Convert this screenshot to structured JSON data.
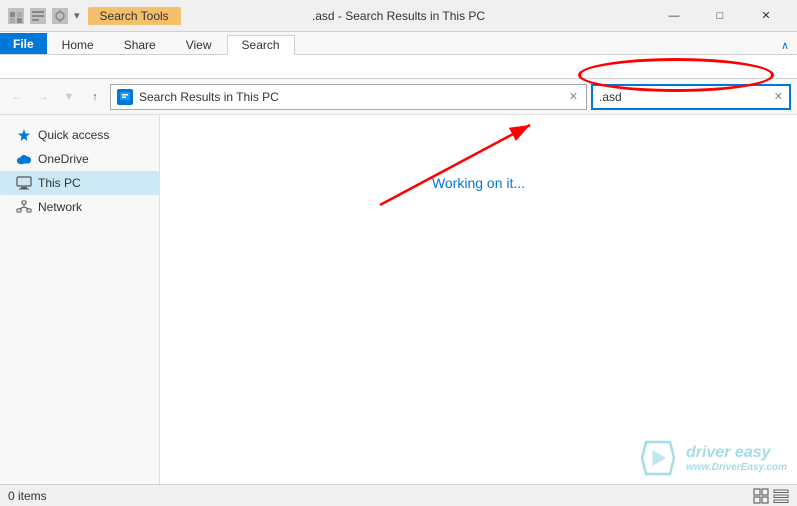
{
  "titlebar": {
    "search_tools_label": "Search Tools",
    "title": ".asd - Search Results in This PC",
    "minimize": "—",
    "maximize": "□",
    "close": "✕"
  },
  "ribbon": {
    "tabs": [
      "File",
      "Home",
      "Share",
      "View",
      "Search"
    ],
    "active_tab": "Search",
    "chevron": "∧"
  },
  "addressbar": {
    "location": "Search Results in This PC",
    "clear_label": "✕",
    "search_value": ".asd",
    "search_clear": "✕"
  },
  "sidebar": {
    "items": [
      {
        "label": "Quick access",
        "icon": "star"
      },
      {
        "label": "OneDrive",
        "icon": "cloud"
      },
      {
        "label": "This PC",
        "icon": "pc",
        "selected": true
      },
      {
        "label": "Network",
        "icon": "network"
      }
    ]
  },
  "content": {
    "working_text": "Working on it..."
  },
  "statusbar": {
    "items_label": "0 items",
    "view_icons": [
      "grid",
      "list"
    ]
  },
  "watermark": {
    "brand": "driver easy",
    "url": "www.DriverEasy.com"
  }
}
